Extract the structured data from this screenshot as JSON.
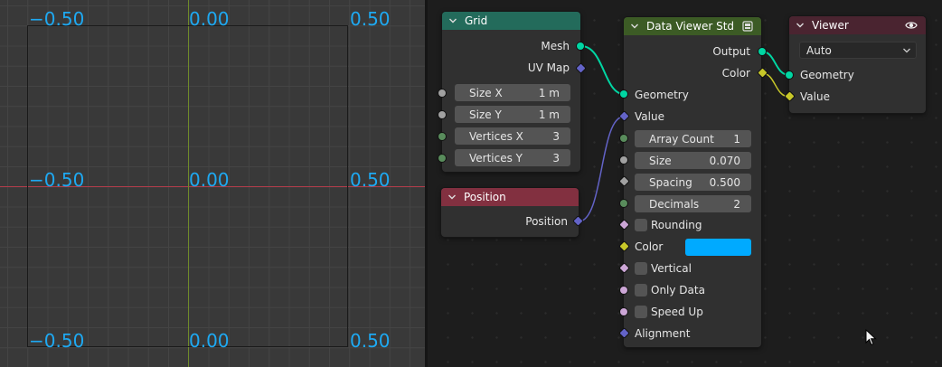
{
  "viewport": {
    "labels": {
      "top_left": "−0.50",
      "top_mid": "0.00",
      "top_right": "0.50",
      "mid_left": "−0.50",
      "mid_mid": "0.00",
      "mid_right": "0.50",
      "bot_left": "−0.50",
      "bot_mid": "0.00",
      "bot_right": "0.50"
    },
    "label_color": "#1ea9f2"
  },
  "nodes": {
    "grid": {
      "title": "Grid",
      "header_color": "#236b5b",
      "outputs": [
        "Mesh",
        "UV Map"
      ],
      "fields": [
        {
          "label": "Size X",
          "value": "1 m"
        },
        {
          "label": "Size Y",
          "value": "1 m"
        },
        {
          "label": "Vertices X",
          "value": "3"
        },
        {
          "label": "Vertices Y",
          "value": "3"
        }
      ]
    },
    "position": {
      "title": "Position",
      "header_color": "#823040",
      "outputs": [
        "Position"
      ]
    },
    "data_viewer": {
      "title": "Data Viewer Std",
      "header_color": "#3c5b25",
      "outputs": [
        "Output",
        "Color"
      ],
      "inputs": [
        "Geometry",
        "Value"
      ],
      "fields": [
        {
          "label": "Array Count",
          "value": "1"
        },
        {
          "label": "Size",
          "value": "0.070"
        },
        {
          "label": "Spacing",
          "value": "0.500"
        },
        {
          "label": "Decimals",
          "value": "2"
        }
      ],
      "checkboxes": [
        "Rounding",
        "Vertical",
        "Only Data",
        "Speed Up"
      ],
      "color_label": "Color",
      "color_value": "#00aaff",
      "alignment_label": "Alignment"
    },
    "viewer": {
      "title": "Viewer",
      "header_color": "#4a2430",
      "domain_select": "Auto",
      "inputs": [
        "Geometry",
        "Value"
      ]
    }
  },
  "socket_colors": {
    "geometry": "#00d6a3",
    "vector": "#6363c7",
    "float": "#a1a1a1",
    "int": "#598c5c",
    "bool": "#cca6d6",
    "color": "#c7c729"
  }
}
